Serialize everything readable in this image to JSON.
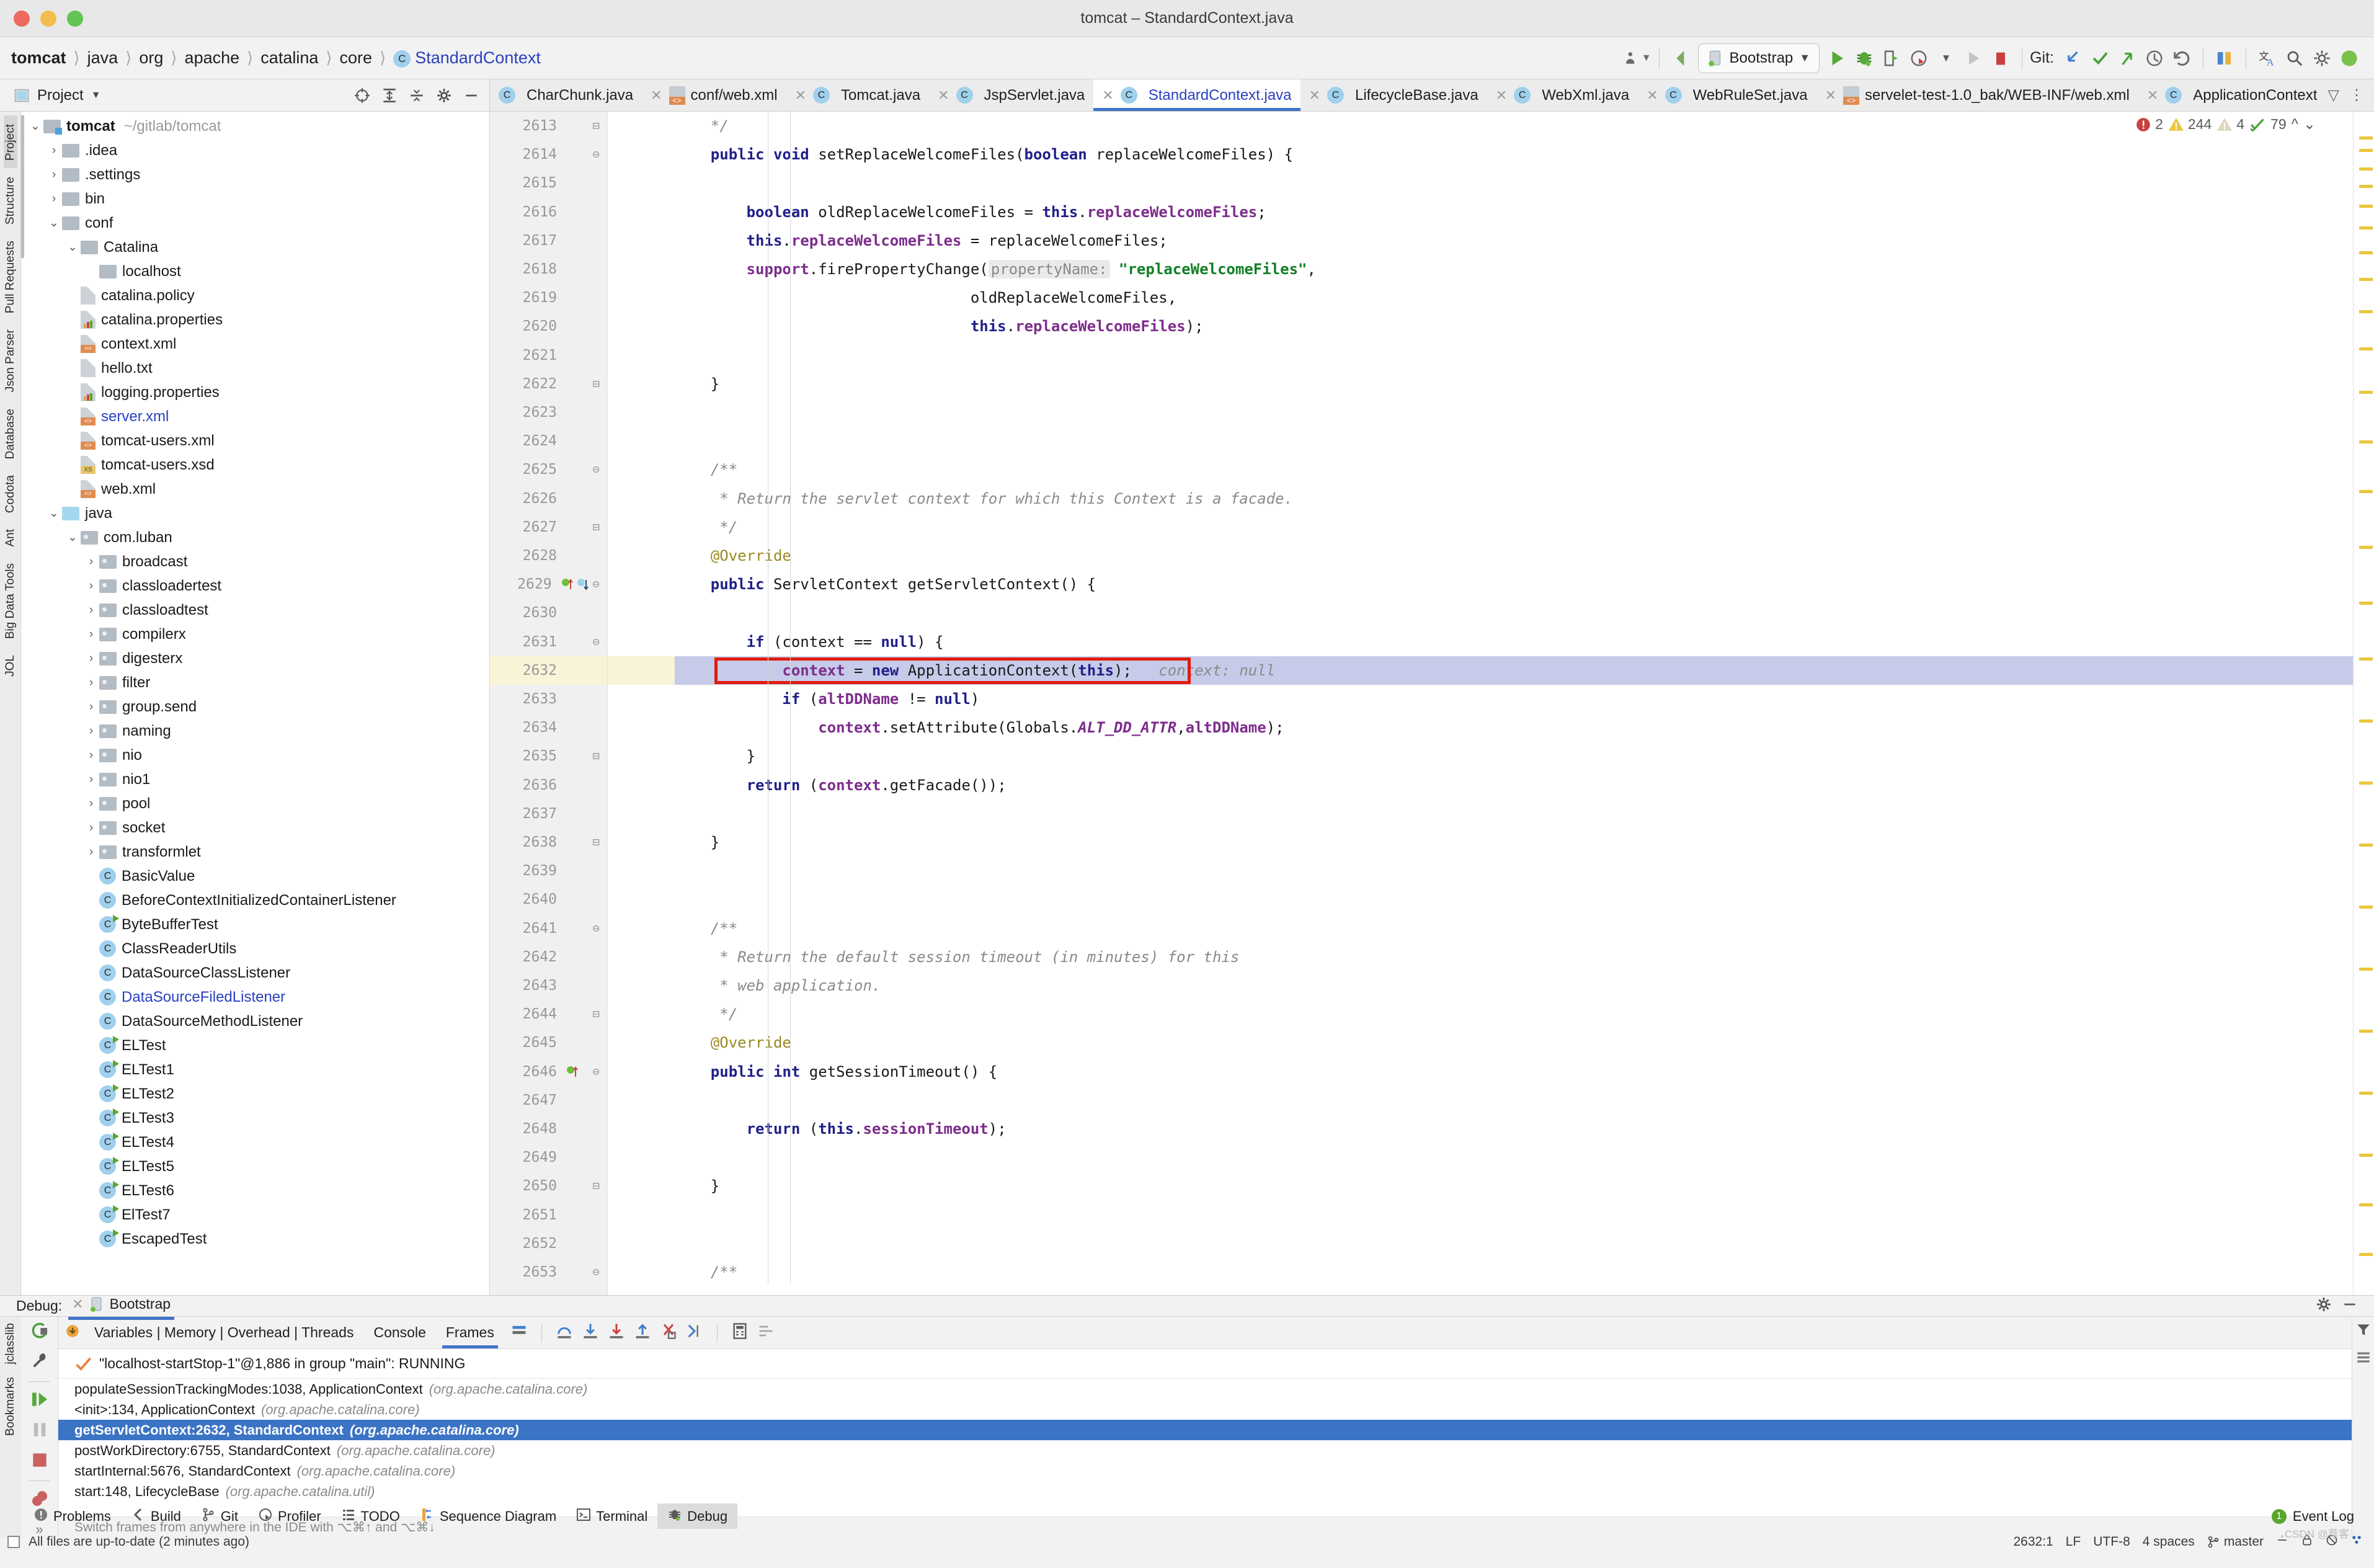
{
  "window": {
    "title": "tomcat – StandardContext.java"
  },
  "breadcrumb": {
    "items": [
      "tomcat",
      "java",
      "org",
      "apache",
      "catalina",
      "core"
    ],
    "class": "StandardContext",
    "class_icon": "C"
  },
  "toolbar": {
    "run_config": "Bootstrap",
    "git_label": "Git:",
    "icons": [
      "profiler-dropdown-icon",
      "back-arrow-icon",
      "run-icon",
      "debug-icon",
      "rerun-icon",
      "coverage-icon",
      "run-dropdown-icon",
      "step-icon",
      "stop-icon",
      "git-update-icon",
      "git-commit-icon",
      "git-push-icon",
      "git-history-icon",
      "git-rollback-icon",
      "compare-icon",
      "translate-icon",
      "search-everywhere-icon",
      "settings-icon",
      "avatar-icon"
    ]
  },
  "project_panel": {
    "title": "Project",
    "toolbar_icons": [
      "locate-icon",
      "expand-all-icon",
      "collapse-all-icon",
      "gear-icon",
      "hide-icon"
    ],
    "tree": [
      {
        "label": "tomcat",
        "path": "~/gitlab/tomcat",
        "icon": "module-folder-icon",
        "indent": 0,
        "chev": "down",
        "bold": true
      },
      {
        "label": ".idea",
        "icon": "folder-icon",
        "indent": 1,
        "chev": "right"
      },
      {
        "label": ".settings",
        "icon": "folder-icon",
        "indent": 1,
        "chev": "right"
      },
      {
        "label": "bin",
        "icon": "folder-icon",
        "indent": 1,
        "chev": "right"
      },
      {
        "label": "conf",
        "icon": "folder-icon",
        "indent": 1,
        "chev": "down"
      },
      {
        "label": "Catalina",
        "icon": "folder-icon",
        "indent": 2,
        "chev": "down"
      },
      {
        "label": "localhost",
        "icon": "folder-icon",
        "indent": 3,
        "chev": "none"
      },
      {
        "label": "catalina.policy",
        "icon": "file-icon",
        "indent": 2,
        "chev": "none"
      },
      {
        "label": "catalina.properties",
        "icon": "properties-file-icon",
        "indent": 2,
        "chev": "none"
      },
      {
        "label": "context.xml",
        "icon": "xml-file-icon",
        "indent": 2,
        "chev": "none"
      },
      {
        "label": "hello.txt",
        "icon": "file-icon",
        "indent": 2,
        "chev": "none"
      },
      {
        "label": "logging.properties",
        "icon": "properties-file-icon",
        "indent": 2,
        "chev": "none"
      },
      {
        "label": "server.xml",
        "icon": "xml-file-icon",
        "indent": 2,
        "chev": "none",
        "modified": true
      },
      {
        "label": "tomcat-users.xml",
        "icon": "xml-file-icon",
        "indent": 2,
        "chev": "none"
      },
      {
        "label": "tomcat-users.xsd",
        "icon": "xsd-file-icon",
        "indent": 2,
        "chev": "none"
      },
      {
        "label": "web.xml",
        "icon": "webxml-file-icon",
        "indent": 2,
        "chev": "none"
      },
      {
        "label": "java",
        "icon": "source-folder-icon",
        "indent": 1,
        "chev": "down"
      },
      {
        "label": "com.luban",
        "icon": "package-icon",
        "indent": 2,
        "chev": "down"
      },
      {
        "label": "broadcast",
        "icon": "package-icon",
        "indent": 3,
        "chev": "right"
      },
      {
        "label": "classloadertest",
        "icon": "package-icon",
        "indent": 3,
        "chev": "right"
      },
      {
        "label": "classloadtest",
        "icon": "package-icon",
        "indent": 3,
        "chev": "right"
      },
      {
        "label": "compilerx",
        "icon": "package-icon",
        "indent": 3,
        "chev": "right"
      },
      {
        "label": "digesterx",
        "icon": "package-icon",
        "indent": 3,
        "chev": "right"
      },
      {
        "label": "filter",
        "icon": "package-icon",
        "indent": 3,
        "chev": "right"
      },
      {
        "label": "group.send",
        "icon": "package-icon",
        "indent": 3,
        "chev": "right"
      },
      {
        "label": "naming",
        "icon": "package-icon",
        "indent": 3,
        "chev": "right"
      },
      {
        "label": "nio",
        "icon": "package-icon",
        "indent": 3,
        "chev": "right"
      },
      {
        "label": "nio1",
        "icon": "package-icon",
        "indent": 3,
        "chev": "right"
      },
      {
        "label": "pool",
        "icon": "package-icon",
        "indent": 3,
        "chev": "right"
      },
      {
        "label": "socket",
        "icon": "package-icon",
        "indent": 3,
        "chev": "right"
      },
      {
        "label": "transformlet",
        "icon": "package-icon",
        "indent": 3,
        "chev": "right"
      },
      {
        "label": "BasicValue",
        "icon": "class-icon",
        "indent": 3,
        "chev": "none"
      },
      {
        "label": "BeforeContextInitializedContainerListener",
        "icon": "class-icon",
        "indent": 3,
        "chev": "none"
      },
      {
        "label": "ByteBufferTest",
        "icon": "runnable-class-icon",
        "indent": 3,
        "chev": "none"
      },
      {
        "label": "ClassReaderUtils",
        "icon": "class-icon",
        "indent": 3,
        "chev": "none"
      },
      {
        "label": "DataSourceClassListener",
        "icon": "class-icon",
        "indent": 3,
        "chev": "none"
      },
      {
        "label": "DataSourceFiledListener",
        "icon": "class-icon",
        "indent": 3,
        "chev": "none",
        "modified": true
      },
      {
        "label": "DataSourceMethodListener",
        "icon": "class-icon",
        "indent": 3,
        "chev": "none"
      },
      {
        "label": "ELTest",
        "icon": "runnable-class-icon",
        "indent": 3,
        "chev": "none"
      },
      {
        "label": "ELTest1",
        "icon": "runnable-class-icon",
        "indent": 3,
        "chev": "none"
      },
      {
        "label": "ELTest2",
        "icon": "runnable-class-icon",
        "indent": 3,
        "chev": "none"
      },
      {
        "label": "ELTest3",
        "icon": "runnable-class-icon",
        "indent": 3,
        "chev": "none"
      },
      {
        "label": "ELTest4",
        "icon": "runnable-class-icon",
        "indent": 3,
        "chev": "none"
      },
      {
        "label": "ELTest5",
        "icon": "runnable-class-icon",
        "indent": 3,
        "chev": "none"
      },
      {
        "label": "ELTest6",
        "icon": "runnable-class-icon",
        "indent": 3,
        "chev": "none"
      },
      {
        "label": "ElTest7",
        "icon": "runnable-class-icon",
        "indent": 3,
        "chev": "none"
      },
      {
        "label": "EscapedTest",
        "icon": "runnable-class-icon",
        "indent": 3,
        "chev": "none"
      }
    ]
  },
  "left_tool_strip": [
    "Project",
    "Structure",
    "Pull Requests",
    "Json Parser",
    "Database",
    "Codota",
    "Ant",
    "Big Data Tools",
    "JOL"
  ],
  "editor_tabs": [
    {
      "label": "CharChunk.java",
      "icon": "class-icon",
      "active": false,
      "truncated": true
    },
    {
      "label": "conf/web.xml",
      "icon": "webxml-file-icon",
      "active": false
    },
    {
      "label": "Tomcat.java",
      "icon": "class-icon",
      "active": false
    },
    {
      "label": "JspServlet.java",
      "icon": "class-icon",
      "active": false
    },
    {
      "label": "StandardContext.java",
      "icon": "class-icon",
      "active": true
    },
    {
      "label": "LifecycleBase.java",
      "icon": "class-icon",
      "active": false
    },
    {
      "label": "WebXml.java",
      "icon": "class-icon",
      "active": false
    },
    {
      "label": "WebRuleSet.java",
      "icon": "class-icon",
      "active": false
    },
    {
      "label": "servelet-test-1.0_bak/WEB-INF/web.xml",
      "icon": "webxml-file-icon",
      "active": false
    },
    {
      "label": "ApplicationContext.java",
      "icon": "class-icon",
      "active": false
    }
  ],
  "inspections": {
    "errors": "2",
    "warnings": "244",
    "weak_warnings": "4",
    "typos": "79"
  },
  "editor": {
    "first_line": 2613,
    "highlight_line": 2632,
    "lines": [
      {
        "n": 2613,
        "fold": "end",
        "html": "    <span class='cmt'>*/</span>"
      },
      {
        "n": 2614,
        "fold": "start",
        "html": "    <span class='kw'>public void</span> setReplaceWelcomeFiles(<span class='kw'>boolean</span> replaceWelcomeFiles) {"
      },
      {
        "n": 2615,
        "html": ""
      },
      {
        "n": 2616,
        "html": "        <span class='kw'>boolean</span> oldReplaceWelcomeFiles = <span class='kw'>this</span>.<span class='fld'>replaceWelcomeFiles</span>;"
      },
      {
        "n": 2617,
        "html": "        <span class='kw'>this</span>.<span class='fld'>replaceWelcomeFiles</span> = replaceWelcomeFiles;"
      },
      {
        "n": 2618,
        "html": "        <span class='fld'>support</span>.firePropertyChange(<span class='hintbg'>propertyName:</span> <span class='str'>\"replaceWelcomeFiles\"</span>,"
      },
      {
        "n": 2619,
        "html": "                                 oldReplaceWelcomeFiles,"
      },
      {
        "n": 2620,
        "html": "                                 <span class='kw'>this</span>.<span class='fld'>replaceWelcomeFiles</span>);"
      },
      {
        "n": 2621,
        "html": ""
      },
      {
        "n": 2622,
        "fold": "end",
        "html": "    }"
      },
      {
        "n": 2623,
        "html": ""
      },
      {
        "n": 2624,
        "html": ""
      },
      {
        "n": 2625,
        "fold": "start",
        "html": "    <span class='cmt'>/**</span>"
      },
      {
        "n": 2626,
        "html": "     <span class='cmt'>* Return the servlet context for which this Context is a facade.</span>"
      },
      {
        "n": 2627,
        "fold": "end",
        "html": "     <span class='cmt'>*/</span>"
      },
      {
        "n": 2628,
        "html": "    <span class='ann'>@Override</span>"
      },
      {
        "n": 2629,
        "fold": "start",
        "marks": "run-to-cursor",
        "html": "    <span class='kw'>public</span> ServletContext getServletContext() {"
      },
      {
        "n": 2630,
        "html": ""
      },
      {
        "n": 2631,
        "fold": "start",
        "html": "        <span class='kw'>if</span> (context == <span class='kw'>null</span>) {"
      },
      {
        "n": 2632,
        "exec": true,
        "html": "            <span class='fld'>context</span> = <span class='kw'>new</span> ApplicationContext(<span class='kw'>this</span>);&nbsp;&nbsp; <span class='cmt'>context: null</span>"
      },
      {
        "n": 2633,
        "html": "            <span class='kw'>if</span> (<span class='fld'>altDDName</span> != <span class='kw'>null</span>)"
      },
      {
        "n": 2634,
        "html": "                <span class='fld'>context</span>.setAttribute(Globals.<span class='stc'>ALT_DD_ATTR</span>,<span class='fld'>altDDName</span>);"
      },
      {
        "n": 2635,
        "fold": "end",
        "html": "        }"
      },
      {
        "n": 2636,
        "html": "        <span class='kw'>return</span> (<span class='fld'>context</span>.getFacade());"
      },
      {
        "n": 2637,
        "html": ""
      },
      {
        "n": 2638,
        "fold": "end",
        "html": "    }"
      },
      {
        "n": 2639,
        "html": ""
      },
      {
        "n": 2640,
        "html": ""
      },
      {
        "n": 2641,
        "fold": "start",
        "html": "    <span class='cmt'>/**</span>"
      },
      {
        "n": 2642,
        "html": "     <span class='cmt'>* Return the default session timeout (in minutes) for this</span>"
      },
      {
        "n": 2643,
        "html": "     <span class='cmt'>* web application.</span>"
      },
      {
        "n": 2644,
        "fold": "end",
        "html": "     <span class='cmt'>*/</span>"
      },
      {
        "n": 2645,
        "html": "    <span class='ann'>@Override</span>"
      },
      {
        "n": 2646,
        "fold": "start",
        "marks": "impl",
        "html": "    <span class='kw'>public int</span> getSessionTimeout() {"
      },
      {
        "n": 2647,
        "html": ""
      },
      {
        "n": 2648,
        "html": "        <span class='kw'>return</span> (<span class='kw'>this</span>.<span class='fld'>sessionTimeout</span>);"
      },
      {
        "n": 2649,
        "html": ""
      },
      {
        "n": 2650,
        "fold": "end",
        "html": "    }"
      },
      {
        "n": 2651,
        "html": ""
      },
      {
        "n": 2652,
        "html": ""
      },
      {
        "n": 2653,
        "fold": "start",
        "html": "    <span class='cmt'>/**</span>"
      }
    ]
  },
  "debug": {
    "label": "Debug:",
    "session_tab": "Bootstrap",
    "tabs": [
      "Variables | Memory | Overhead | Threads",
      "Console",
      "Frames"
    ],
    "active_tab": "Frames",
    "thread": "\"localhost-startStop-1\"@1,886 in group \"main\": RUNNING",
    "frames": [
      {
        "name": "populateSessionTrackingModes:1038, ApplicationContext",
        "pkg": "(org.apache.catalina.core)",
        "selected": false
      },
      {
        "name": "<init>:134, ApplicationContext",
        "pkg": "(org.apache.catalina.core)",
        "selected": false
      },
      {
        "name": "getServletContext:2632, StandardContext",
        "pkg": "(org.apache.catalina.core)",
        "selected": true
      },
      {
        "name": "postWorkDirectory:6755, StandardContext",
        "pkg": "(org.apache.catalina.core)",
        "selected": false
      },
      {
        "name": "startInternal:5676, StandardContext",
        "pkg": "(org.apache.catalina.core)",
        "selected": false
      },
      {
        "name": "start:148, LifecycleBase",
        "pkg": "(org.apache.catalina.util)",
        "selected": false
      }
    ],
    "hint": "Switch frames from anywhere in the IDE with ⌥⌘↑ and ⌥⌘↓",
    "left_strip": [
      "jclasslib",
      "Bookmarks"
    ],
    "expand_label": "»"
  },
  "bottom_tools": [
    {
      "label": "Problems",
      "icon": "problems-icon",
      "active": false
    },
    {
      "label": "Build",
      "icon": "build-icon",
      "active": false
    },
    {
      "label": "Git",
      "icon": "git-icon",
      "active": false
    },
    {
      "label": "Profiler",
      "icon": "profiler-icon",
      "active": false
    },
    {
      "label": "TODO",
      "icon": "todo-icon",
      "active": false
    },
    {
      "label": "Sequence Diagram",
      "icon": "sequence-diagram-icon",
      "active": false
    },
    {
      "label": "Terminal",
      "icon": "terminal-icon",
      "active": false
    },
    {
      "label": "Debug",
      "icon": "debug-icon",
      "active": true
    }
  ],
  "event_log": {
    "label": "Event Log",
    "count": "1"
  },
  "status_bar": {
    "message": "All files are up-to-date (2 minutes ago)",
    "caret": "2632:1",
    "line_sep": "LF",
    "encoding": "UTF-8",
    "indent": "4 spaces",
    "branch": "master"
  },
  "colors": {
    "accent": "#4074c9",
    "selection": "#3b74c4",
    "exec_line": "#c5cbe8",
    "caret_line": "#f9f4d8",
    "redbox": "#e01b0d",
    "link": "#2a41bf"
  },
  "watermark": "CSDN @荐客"
}
